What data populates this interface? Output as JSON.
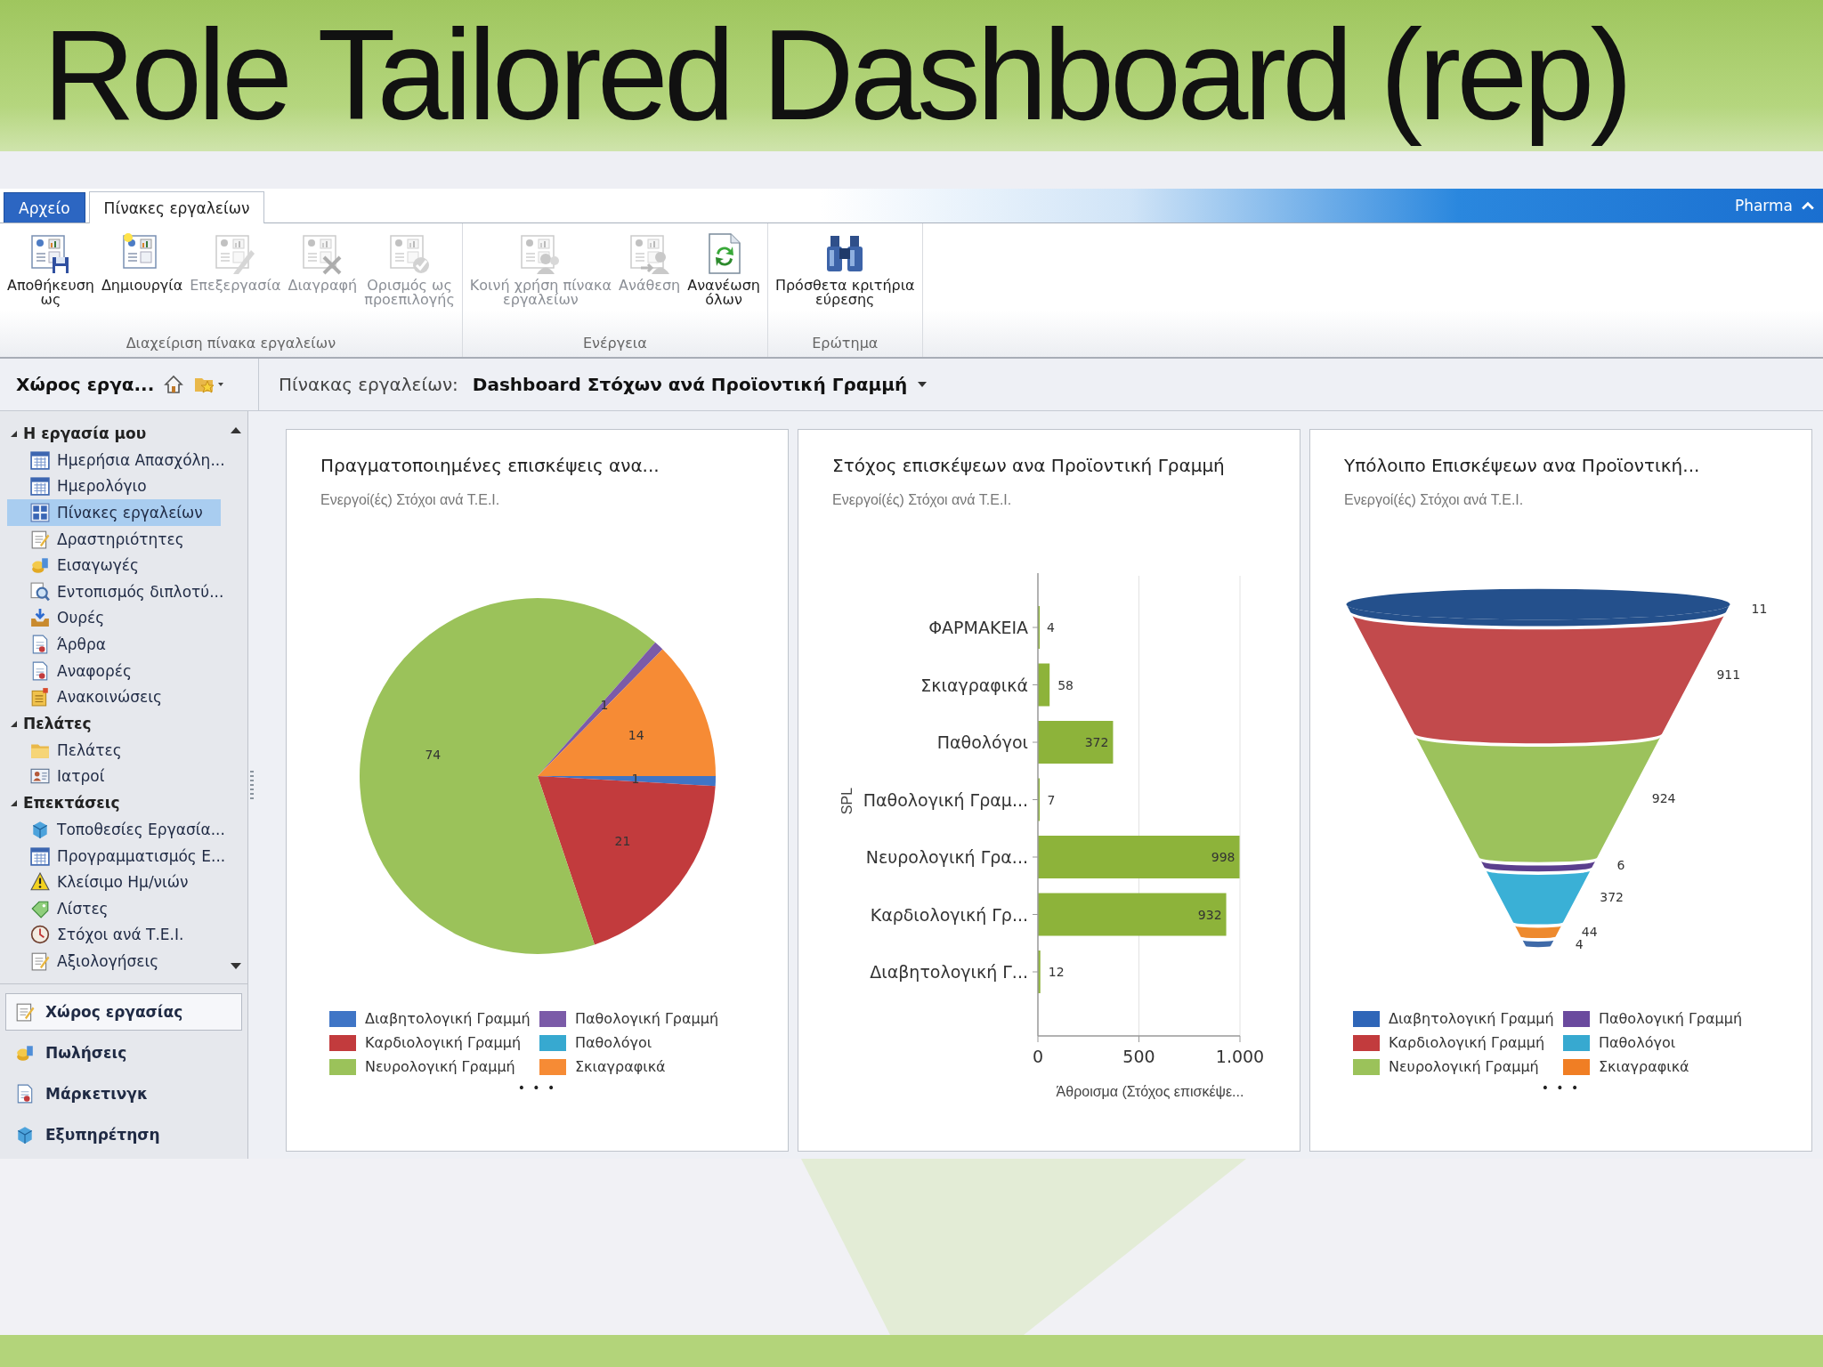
{
  "slide_title": "Role Tailored Dashboard (rep)",
  "tabs": [
    {
      "label": "Αρχείο",
      "kind": "file",
      "selected": false
    },
    {
      "label": "Πίνακες εργαλείων",
      "kind": "tab",
      "selected": true
    }
  ],
  "org_name": "Pharma",
  "ribbon": [
    {
      "label": "Διαχείριση πίνακα εργαλείων",
      "buttons": [
        {
          "label": "Αποθήκευση\nως",
          "disabled": false
        },
        {
          "label": "Δημιουργία",
          "disabled": false
        },
        {
          "label": "Επεξεργασία",
          "disabled": true
        },
        {
          "label": "Διαγραφή",
          "disabled": true
        },
        {
          "label": "Ορισμός ως\nπροεπιλογής",
          "disabled": true
        }
      ]
    },
    {
      "label": "Ενέργεια",
      "buttons": [
        {
          "label": "Κοινή χρήση πίνακα\nεργαλείων",
          "disabled": true
        },
        {
          "label": "Ανάθεση",
          "disabled": true
        },
        {
          "label": "Ανανέωση\nόλων",
          "disabled": false
        }
      ]
    },
    {
      "label": "Ερώτημα",
      "buttons": [
        {
          "label": "Πρόσθετα κριτήρια\nεύρεσης",
          "disabled": false
        }
      ]
    }
  ],
  "sidebar": {
    "title": "Χώρος εργα...",
    "sections": [
      {
        "label": "Η εργασία μου",
        "expanded": true,
        "items": [
          {
            "label": "Ημερήσια Απασχόλη...",
            "selected": false
          },
          {
            "label": "Ημερολόγιο",
            "selected": false
          },
          {
            "label": "Πίνακες εργαλείων",
            "selected": true
          },
          {
            "label": "Δραστηριότητες",
            "selected": false
          },
          {
            "label": "Εισαγωγές",
            "selected": false
          },
          {
            "label": "Εντοπισμός διπλοτύ...",
            "selected": false
          },
          {
            "label": "Ουρές",
            "selected": false
          },
          {
            "label": "Άρθρα",
            "selected": false
          },
          {
            "label": "Αναφορές",
            "selected": false
          },
          {
            "label": "Ανακοινώσεις",
            "selected": false
          }
        ]
      },
      {
        "label": "Πελάτες",
        "expanded": true,
        "items": [
          {
            "label": "Πελάτες",
            "selected": false
          },
          {
            "label": "Ιατροί",
            "selected": false
          }
        ]
      },
      {
        "label": "Επεκτάσεις",
        "expanded": true,
        "items": [
          {
            "label": "Τοποθεσίες Εργασία...",
            "selected": false
          },
          {
            "label": "Προγραμματισμός Ε...",
            "selected": false
          },
          {
            "label": "Κλείσιμο Ημ/νιών",
            "selected": false
          },
          {
            "label": "Λίστες",
            "selected": false
          },
          {
            "label": "Στόχοι ανά Τ.Ε.Ι.",
            "selected": false
          },
          {
            "label": "Αξιολογήσεις",
            "selected": false
          }
        ]
      }
    ],
    "nav": [
      {
        "label": "Χώρος εργασίας",
        "selected": true
      },
      {
        "label": "Πωλήσεις",
        "selected": false
      },
      {
        "label": "Μάρκετινγκ",
        "selected": false
      },
      {
        "label": "Εξυπηρέτηση",
        "selected": false
      }
    ]
  },
  "dashboard": {
    "label": "Πίνακας εργαλείων:",
    "name": "Dashboard Στόχων ανά Προϊοντική Γραμμή"
  },
  "cards": [
    {
      "title": "Πραγματοποιημένες επισκέψεις ανα...",
      "subtitle": "Ενεργοί(ές) Στόχοι ανά Τ.Ε.Ι.",
      "chart_data": {
        "type": "pie",
        "categories": [
          "Διαβητολογική Γραμμή",
          "Καρδιολογική Γραμμή",
          "Νευρολογική Γραμμή",
          "Παθολογική Γραμμή",
          "Παθολόγοι",
          "Σκιαγραφικά"
        ],
        "values": [
          1,
          21,
          74,
          1,
          0,
          14
        ],
        "colors": [
          "#3f75c6",
          "#c23b3d",
          "#9bc25a",
          "#7b5ba8",
          "#37a9d0",
          "#f68b35"
        ],
        "data_labels": true
      },
      "more": "• • •"
    },
    {
      "title": "Στόχος επισκέψεων ανα Προϊοντική Γραμμή",
      "subtitle": "Ενεργοί(ές) Στόχοι ανά Τ.Ε.Ι.",
      "chart_data": {
        "type": "bar",
        "orientation": "horizontal",
        "xlabel": "Άθροισμα (Στόχος επισκέψε...",
        "ylabel": "SPL",
        "categories": [
          "ΦΑΡΜΑΚΕΙΑ",
          "Σκιαγραφικά",
          "Παθολόγοι",
          "Παθολογική Γραμ...",
          "Νευρολογική Γρα...",
          "Καρδιολογική Γρ...",
          "Διαβητολογική Γ..."
        ],
        "series": [
          {
            "color": "#8db33a",
            "values": [
              4,
              58,
              372,
              7,
              998,
              932,
              12
            ]
          }
        ],
        "xlim": [
          0,
          1000
        ],
        "xticks": [
          0,
          500,
          {
            "value": 1000,
            "label": "1.000"
          }
        ],
        "data_labels": true
      }
    },
    {
      "kind": "funnel",
      "title": "Υπόλοιπο Επισκέψεων ανα Προϊοντική...",
      "subtitle": "Ενεργοί(ές) Στόχοι ανά Τ.Ε.Ι.",
      "segments": [
        {
          "label": "11",
          "color": "#24508c"
        },
        {
          "label": "911",
          "color": "#c24a4c"
        },
        {
          "label": "924",
          "color": "#9cc25c"
        },
        {
          "label": "6",
          "color": "#5b3f8e"
        },
        {
          "label": "372",
          "color": "#3ab0d6"
        },
        {
          "label": "44",
          "color": "#ee8a2e"
        },
        {
          "label": "4",
          "color": "#3f6aa8"
        }
      ],
      "legend": [
        {
          "label": "Διαβητολογική Γραμμή",
          "color": "#2f66b8"
        },
        {
          "label": "Καρδιολογική Γραμμή",
          "color": "#c23b3d"
        },
        {
          "label": "Νευρολογική Γραμμή",
          "color": "#9bc25a"
        },
        {
          "label": "Παθολογική Γραμμή",
          "color": "#6a4a9e"
        },
        {
          "label": "Παθολόγοι",
          "color": "#37a9d0"
        },
        {
          "label": "Σκιαγραφικά",
          "color": "#f07e24"
        }
      ],
      "more": "• • •"
    }
  ]
}
